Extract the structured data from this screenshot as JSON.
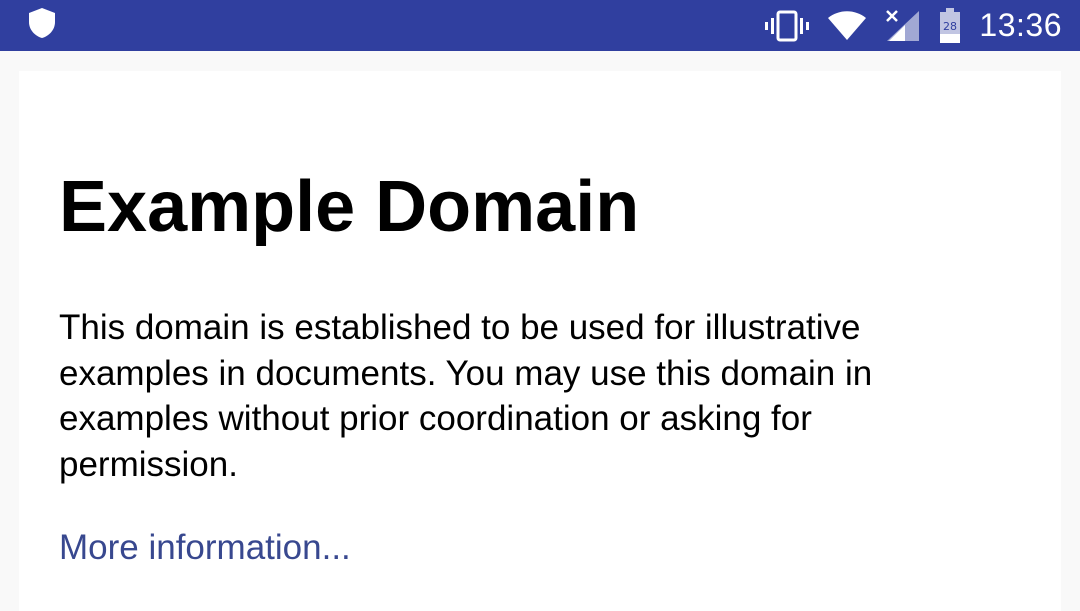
{
  "status_bar": {
    "time": "13:36",
    "battery_level": "28",
    "color": "#303f9f",
    "icons": [
      "shield-icon",
      "vibrate-icon",
      "wifi-icon",
      "cell-signal-no-data-icon",
      "battery-icon"
    ]
  },
  "page": {
    "title": "Example Domain",
    "body": "This domain is established to be used for illustrative examples in documents. You may use this domain in examples without prior coordination or asking for permission.",
    "link_label": "More information...",
    "link_color": "#38488f"
  }
}
